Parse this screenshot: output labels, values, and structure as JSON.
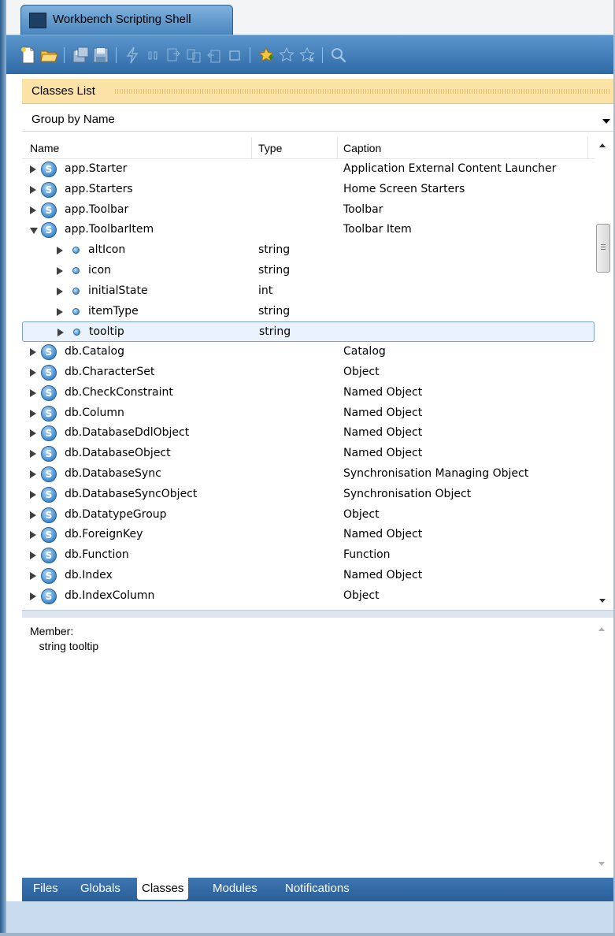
{
  "window": {
    "title": "Workbench Scripting Shell"
  },
  "toolbar": {
    "icons": [
      "new-file-icon",
      "open-folder-icon",
      "save-as-icon",
      "save-icon",
      "run-icon",
      "pause-icon",
      "step-into-icon",
      "step-over-icon",
      "step-out-icon",
      "stop-icon",
      "add-bookmark-icon",
      "bookmark-icon",
      "remove-bookmark-icon",
      "search-icon"
    ]
  },
  "classes_list": {
    "header": "Classes List",
    "group_by": "Group by Name",
    "columns": {
      "name": "Name",
      "type": "Type",
      "caption": "Caption"
    },
    "rows": [
      {
        "kind": "class",
        "depth": 0,
        "expander": "closed",
        "name": "app.Starter",
        "type": "",
        "caption": "Application External Content Launcher"
      },
      {
        "kind": "class",
        "depth": 0,
        "expander": "closed",
        "name": "app.Starters",
        "type": "",
        "caption": "Home Screen Starters"
      },
      {
        "kind": "class",
        "depth": 0,
        "expander": "closed",
        "name": "app.Toolbar",
        "type": "",
        "caption": "Toolbar"
      },
      {
        "kind": "class",
        "depth": 0,
        "expander": "open",
        "name": "app.ToolbarItem",
        "type": "",
        "caption": "Toolbar Item"
      },
      {
        "kind": "member",
        "depth": 1,
        "expander": "closed",
        "name": "altIcon",
        "type": "string",
        "caption": ""
      },
      {
        "kind": "member",
        "depth": 1,
        "expander": "closed",
        "name": "icon",
        "type": "string",
        "caption": ""
      },
      {
        "kind": "member",
        "depth": 1,
        "expander": "closed",
        "name": "initialState",
        "type": "int",
        "caption": ""
      },
      {
        "kind": "member",
        "depth": 1,
        "expander": "closed",
        "name": "itemType",
        "type": "string",
        "caption": ""
      },
      {
        "kind": "member",
        "depth": 1,
        "expander": "closed",
        "name": "tooltip",
        "type": "string",
        "caption": "",
        "selected": true
      },
      {
        "kind": "class",
        "depth": 0,
        "expander": "closed",
        "name": "db.Catalog",
        "type": "",
        "caption": "Catalog"
      },
      {
        "kind": "class",
        "depth": 0,
        "expander": "closed",
        "name": "db.CharacterSet",
        "type": "",
        "caption": "Object"
      },
      {
        "kind": "class",
        "depth": 0,
        "expander": "closed",
        "name": "db.CheckConstraint",
        "type": "",
        "caption": "Named Object"
      },
      {
        "kind": "class",
        "depth": 0,
        "expander": "closed",
        "name": "db.Column",
        "type": "",
        "caption": "Named Object"
      },
      {
        "kind": "class",
        "depth": 0,
        "expander": "closed",
        "name": "db.DatabaseDdlObject",
        "type": "",
        "caption": "Named Object"
      },
      {
        "kind": "class",
        "depth": 0,
        "expander": "closed",
        "name": "db.DatabaseObject",
        "type": "",
        "caption": "Named Object"
      },
      {
        "kind": "class",
        "depth": 0,
        "expander": "closed",
        "name": "db.DatabaseSync",
        "type": "",
        "caption": "Synchronisation Managing Object"
      },
      {
        "kind": "class",
        "depth": 0,
        "expander": "closed",
        "name": "db.DatabaseSyncObject",
        "type": "",
        "caption": "Synchronisation Object"
      },
      {
        "kind": "class",
        "depth": 0,
        "expander": "closed",
        "name": "db.DatatypeGroup",
        "type": "",
        "caption": "Object"
      },
      {
        "kind": "class",
        "depth": 0,
        "expander": "closed",
        "name": "db.ForeignKey",
        "type": "",
        "caption": "Named Object"
      },
      {
        "kind": "class",
        "depth": 0,
        "expander": "closed",
        "name": "db.Function",
        "type": "",
        "caption": "Function"
      },
      {
        "kind": "class",
        "depth": 0,
        "expander": "closed",
        "name": "db.Index",
        "type": "",
        "caption": "Named Object"
      },
      {
        "kind": "class",
        "depth": 0,
        "expander": "closed",
        "name": "db.IndexColumn",
        "type": "",
        "caption": "Object"
      }
    ]
  },
  "member_info": {
    "label": "Member:",
    "value": "string tooltip"
  },
  "bottom_tabs": [
    {
      "label": "Files",
      "active": false
    },
    {
      "label": "Globals",
      "active": false
    },
    {
      "label": "Classes",
      "active": true
    },
    {
      "label": "Modules",
      "active": false
    },
    {
      "label": "Notifications",
      "active": false
    }
  ],
  "colors": {
    "toolbar": "#3f7db9",
    "header_bg": "#fbe3a8",
    "selection_border": "#7da2ce",
    "class_icon": "#3e8ad0"
  }
}
